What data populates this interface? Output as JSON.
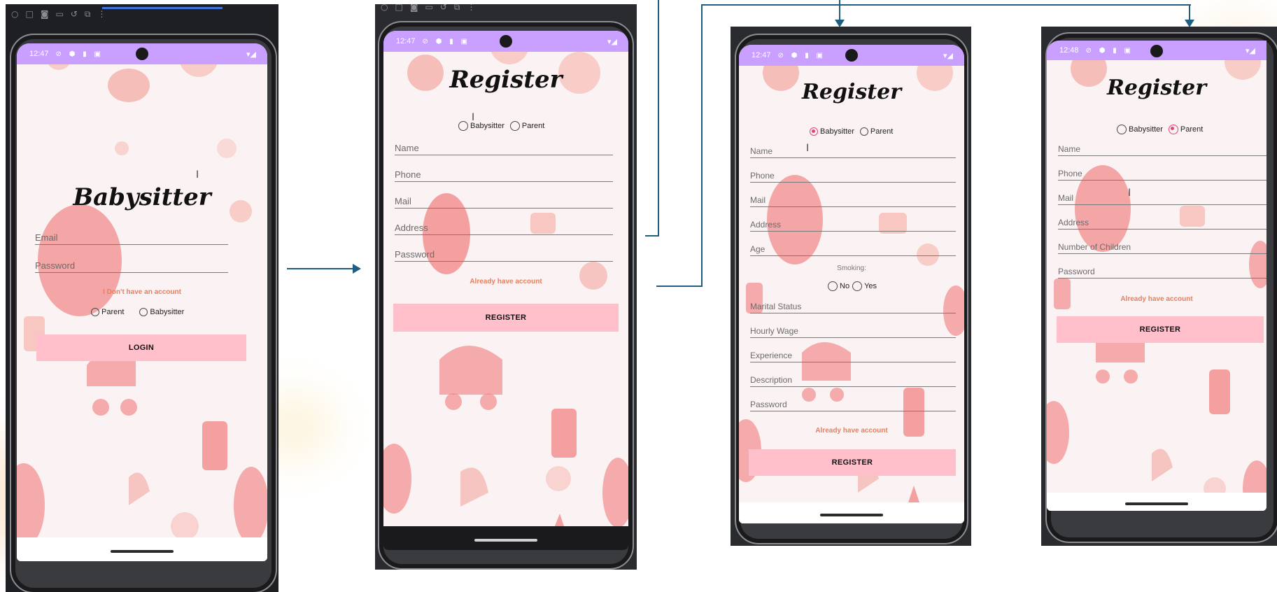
{
  "colors": {
    "status_bar": "#c9a0ff",
    "button": "#ffc0cc",
    "link": "#e58060",
    "radio_checked": "#e0457b",
    "arrow": "#1f5e80"
  },
  "screens": {
    "login": {
      "status_time": "12:47",
      "title": "Babysitter",
      "fields": [
        "Email",
        "Password"
      ],
      "link": "I Don't have an account",
      "radios": [
        {
          "label": "Parent",
          "checked": false
        },
        {
          "label": "Babysitter",
          "checked": false
        }
      ],
      "button": "LOGIN"
    },
    "register_empty": {
      "status_time": "12:47",
      "title": "Register",
      "radios": [
        {
          "label": "Babysitter",
          "checked": false
        },
        {
          "label": "Parent",
          "checked": false
        }
      ],
      "fields": [
        "Name",
        "Phone",
        "Mail",
        "Address",
        "Password"
      ],
      "link": "Already have account",
      "button": "REGISTER"
    },
    "register_babysitter": {
      "status_time": "12:47",
      "title": "Register",
      "radios": [
        {
          "label": "Babysitter",
          "checked": true
        },
        {
          "label": "Parent",
          "checked": false
        }
      ],
      "fields_top": [
        "Name",
        "Phone",
        "Mail",
        "Address",
        "Age"
      ],
      "smoking_label": "Smoking:",
      "smoking_radios": [
        {
          "label": "No",
          "checked": false
        },
        {
          "label": "Yes",
          "checked": false
        }
      ],
      "fields_bottom": [
        "Marital Status",
        "Hourly Wage",
        "Experience",
        "Description",
        "Password"
      ],
      "link": "Already have account",
      "button": "REGISTER"
    },
    "register_parent": {
      "status_time": "12:48",
      "title": "Register",
      "radios": [
        {
          "label": "Babysitter",
          "checked": false
        },
        {
          "label": "Parent",
          "checked": true
        }
      ],
      "fields": [
        "Name",
        "Phone",
        "Mail",
        "Address",
        "Number of Children",
        "Password"
      ],
      "link": "Already have account",
      "button": "REGISTER"
    }
  },
  "icons": {
    "toolbar": [
      "power-icon",
      "square-icon",
      "camera-icon",
      "video-icon",
      "rotate-icon",
      "resize-icon",
      "more-icon"
    ],
    "status": [
      "location-off-icon",
      "shield-icon",
      "sim-icon",
      "notification-icon",
      "wifi-icon",
      "signal-icon"
    ]
  }
}
